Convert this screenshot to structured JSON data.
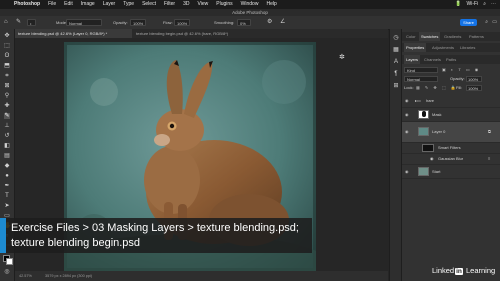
{
  "menubar": {
    "app": "Photoshop",
    "items": [
      "Photoshop",
      "File",
      "Edit",
      "Image",
      "Layer",
      "Type",
      "Select",
      "Filter",
      "3D",
      "View",
      "Plugins",
      "Window",
      "Help"
    ],
    "status": [
      "🔋",
      "Wi-Fi",
      "⌕",
      "⋯"
    ]
  },
  "window": {
    "title": "Adobe Photoshop"
  },
  "options": {
    "mode_label": "Mode:",
    "mode_value": "Normal",
    "opacity_label": "Opacity:",
    "opacity_value": "100%",
    "flow_label": "Flow:",
    "flow_value": "100%",
    "smoothing_label": "Smoothing:",
    "smoothing_value": "0%",
    "share": "Share"
  },
  "tabs": [
    {
      "label": "texture blending.psd @ 42.6% (Layer 0, RGB/8*) *"
    },
    {
      "label": "texture blending begin.psd @ 42.6% (hare, RGB/8*)"
    }
  ],
  "statusbar": {
    "zoom": "42.57%",
    "doc": "3579 px x 2894 px (300 ppi)"
  },
  "panels": {
    "top_tabs": [
      "Color",
      "Swatches",
      "Gradients",
      "Patterns"
    ],
    "mid_tabs": [
      "Properties",
      "Adjustments",
      "Libraries"
    ],
    "layer_tabs": [
      "Layers",
      "Channels",
      "Paths"
    ],
    "kind": "Kind",
    "blend_mode": "Normal",
    "opacity_label": "Opacity:",
    "opacity_value": "100%",
    "lock_label": "Lock:",
    "fill_label": "Fill:",
    "fill_value": "100%",
    "layers": [
      {
        "name": "hare",
        "type": "group"
      },
      {
        "name": "Mask",
        "type": "mask"
      },
      {
        "name": "Layer 0",
        "type": "layer"
      },
      {
        "name": "Smart Filters",
        "type": "filter"
      },
      {
        "name": "Gaussian Blur",
        "type": "filter-item"
      },
      {
        "name": "Start",
        "type": "layer"
      }
    ]
  },
  "caption": {
    "line1": "Exercise Files > 03 Masking Layers > texture blending.psd;",
    "line2": "texture blending begin.psd"
  },
  "watermark": {
    "pre": "Linked",
    "in": "in",
    "post": "Learning"
  }
}
